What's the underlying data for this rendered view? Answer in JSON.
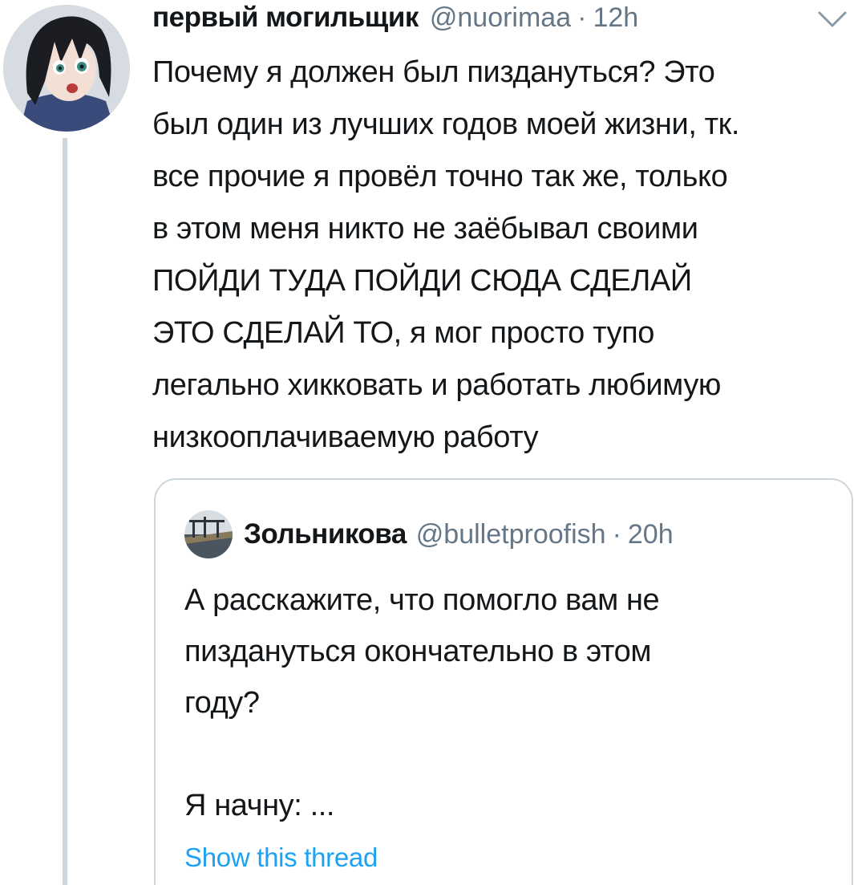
{
  "tweet": {
    "author": {
      "name": "первый могильщик",
      "handle": "@nuorimaa",
      "separator": "·",
      "time": "12h"
    },
    "text": "Почему я должен был пиздануться? Это\nбыл один из лучших годов моей жизни, тк.\nвсе прочие я провёл точно так же, только\nв этом меня никто не заёбывал своими\nПОЙДИ ТУДА ПОЙДИ СЮДА СДЕЛАЙ\nЭТО СДЕЛАЙ ТО, я мог просто тупо\nлегально хикковать и работать любимую\nнизкооплачиваемую работу",
    "menu_icon": "chevron-down-icon"
  },
  "quote": {
    "author": {
      "name": "Зольникова",
      "handle": "@bulletproofish",
      "separator": "·",
      "time": "20h"
    },
    "text": "А расскажите, что помогло вам не\nпиздануться окончательно в этом\nгоду?\n\nЯ начну: ...",
    "show_thread": "Show this thread"
  },
  "colors": {
    "text": "#14171a",
    "secondary": "#657786",
    "border": "#ccd6dd",
    "link": "#1da1f2"
  }
}
